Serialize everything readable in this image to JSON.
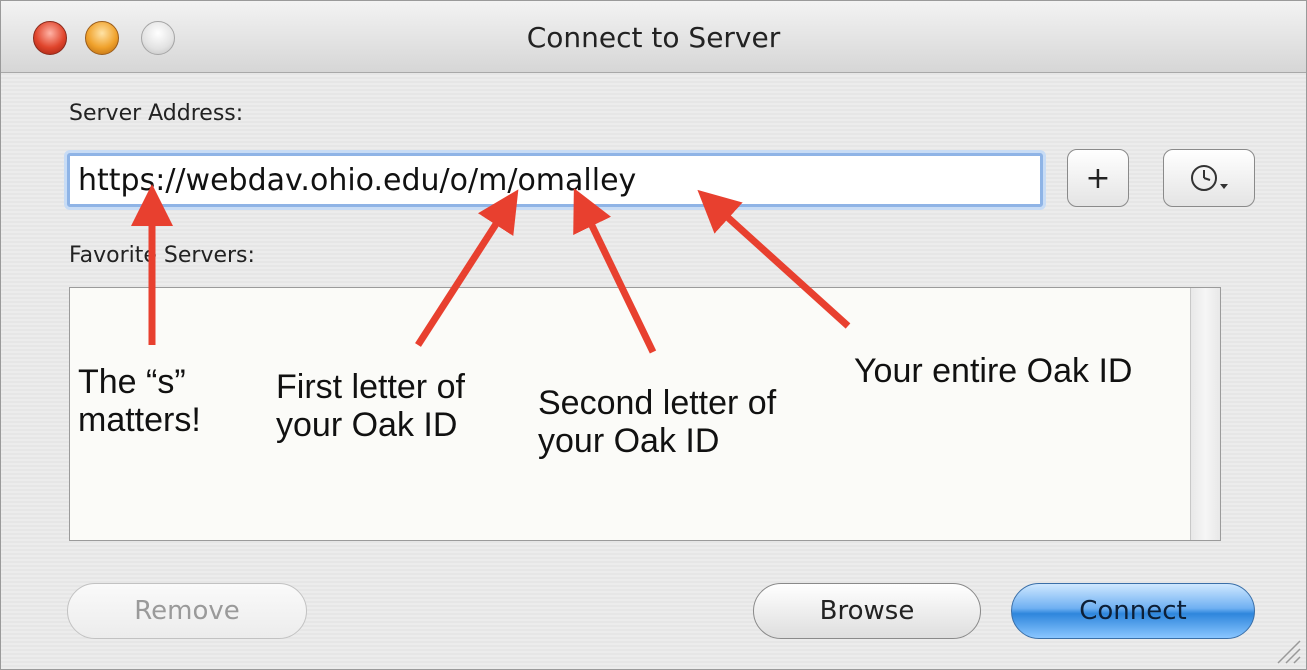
{
  "window": {
    "title": "Connect to Server"
  },
  "server_address": {
    "label": "Server Address:",
    "value": "https://webdav.ohio.edu/o/m/omalley",
    "add_label": "+",
    "recent_icon": "clock-icon"
  },
  "favorites": {
    "label": "Favorite Servers:",
    "items": []
  },
  "buttons": {
    "remove": "Remove",
    "browse": "Browse",
    "connect": "Connect"
  },
  "annotations": {
    "s_line1": "The “s”",
    "s_line2": "matters!",
    "first_line1": "First letter of",
    "first_line2": "your Oak ID",
    "second_line1": "Second letter of",
    "second_line2": "your Oak ID",
    "entire": "Your entire Oak ID"
  },
  "colors": {
    "arrow": "#e8402f",
    "focus_ring": "#8fb4e6",
    "connect_blue": "#2e86dc"
  }
}
